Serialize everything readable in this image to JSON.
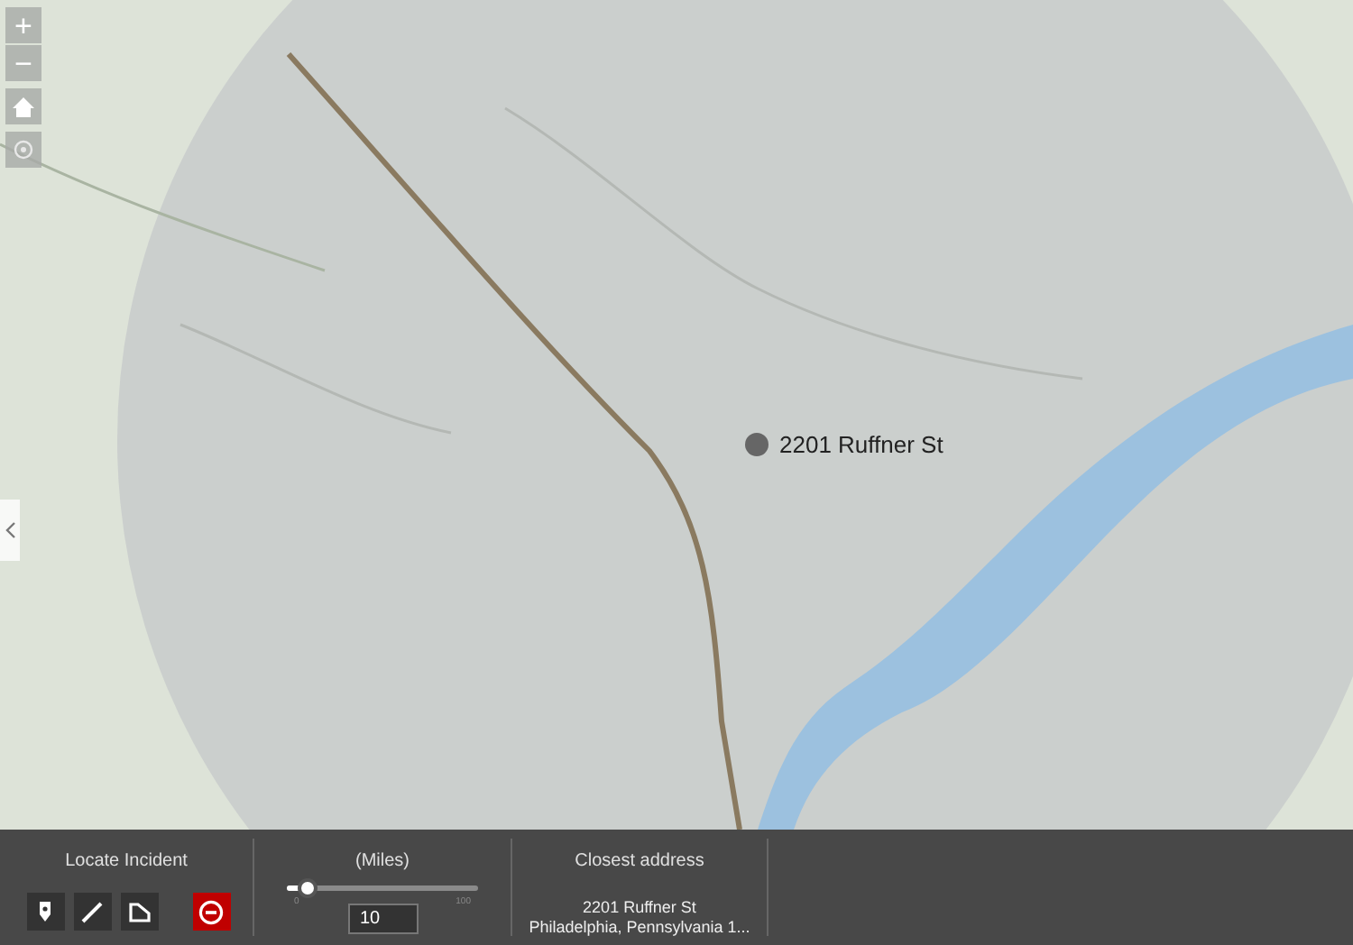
{
  "map": {
    "zoom_in": "+",
    "zoom_out": "−",
    "marker": {
      "label": "2201 Ruffner St"
    }
  },
  "panel": {
    "locate": {
      "title": "Locate Incident",
      "tools": [
        {
          "kind": "point"
        },
        {
          "kind": "line"
        },
        {
          "kind": "polygon"
        },
        {
          "kind": "clear"
        }
      ]
    },
    "distance": {
      "title": "(Miles)",
      "level": 0.1,
      "min": "0",
      "max": "100",
      "value": "10"
    },
    "address": {
      "title": "Closest address",
      "lines": [
        "2201 Ruffner St",
        "Philadelphia, Pennsylvania 1..."
      ]
    }
  }
}
